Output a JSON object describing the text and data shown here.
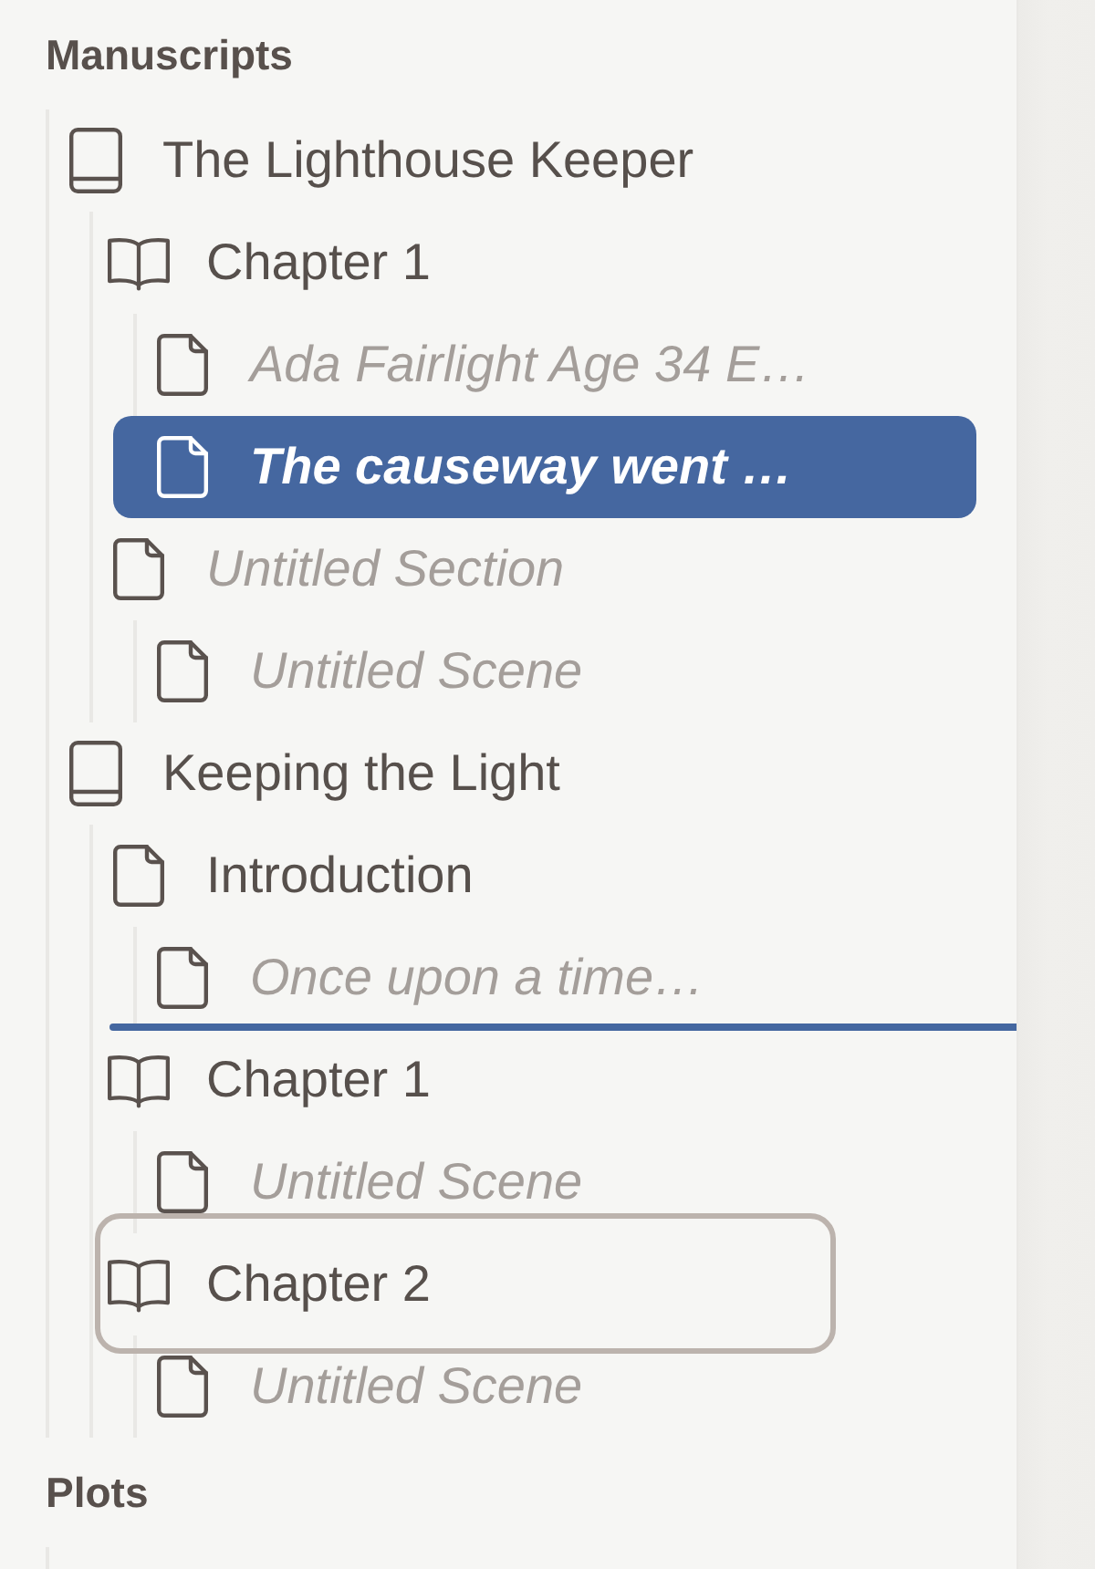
{
  "sections": [
    {
      "title": "Manuscripts",
      "items": [
        {
          "kind": "book",
          "label": "The Lighthouse Keeper",
          "untitled": false,
          "selected": false,
          "dragging": false,
          "drop_after": false,
          "children": [
            {
              "kind": "chapter",
              "label": "Chapter 1",
              "untitled": false,
              "selected": false,
              "dragging": false,
              "drop_after": false,
              "children": [
                {
                  "kind": "scene",
                  "label": "Ada Fairlight Age 34 E…",
                  "untitled": true,
                  "selected": false,
                  "dragging": false,
                  "drop_after": false
                },
                {
                  "kind": "scene",
                  "label": "The causeway went …",
                  "untitled": true,
                  "selected": true,
                  "dragging": false,
                  "drop_after": false
                }
              ]
            },
            {
              "kind": "section",
              "label": "Untitled Section",
              "untitled": true,
              "selected": false,
              "dragging": false,
              "drop_after": false,
              "children": [
                {
                  "kind": "scene",
                  "label": "Untitled Scene",
                  "untitled": true,
                  "selected": false,
                  "dragging": false,
                  "drop_after": false
                }
              ]
            }
          ]
        },
        {
          "kind": "book",
          "label": "Keeping the Light",
          "untitled": false,
          "selected": false,
          "dragging": false,
          "drop_after": false,
          "children": [
            {
              "kind": "section",
              "label": "Introduction",
              "untitled": false,
              "selected": false,
              "dragging": false,
              "drop_after": true,
              "children": [
                {
                  "kind": "scene",
                  "label": "Once upon a time…",
                  "untitled": true,
                  "selected": false,
                  "dragging": false,
                  "drop_after": false
                }
              ]
            },
            {
              "kind": "chapter",
              "label": "Chapter 1",
              "untitled": false,
              "selected": false,
              "dragging": false,
              "drop_after": false,
              "children": [
                {
                  "kind": "scene",
                  "label": "Untitled Scene",
                  "untitled": true,
                  "selected": false,
                  "dragging": false,
                  "drop_after": false
                }
              ]
            },
            {
              "kind": "chapter",
              "label": "Chapter 2",
              "untitled": false,
              "selected": false,
              "dragging": true,
              "drop_after": false,
              "children": [
                {
                  "kind": "scene",
                  "label": "Untitled Scene",
                  "untitled": true,
                  "selected": false,
                  "dragging": false,
                  "drop_after": false
                }
              ]
            }
          ]
        }
      ]
    },
    {
      "title": "Plots"
    }
  ]
}
